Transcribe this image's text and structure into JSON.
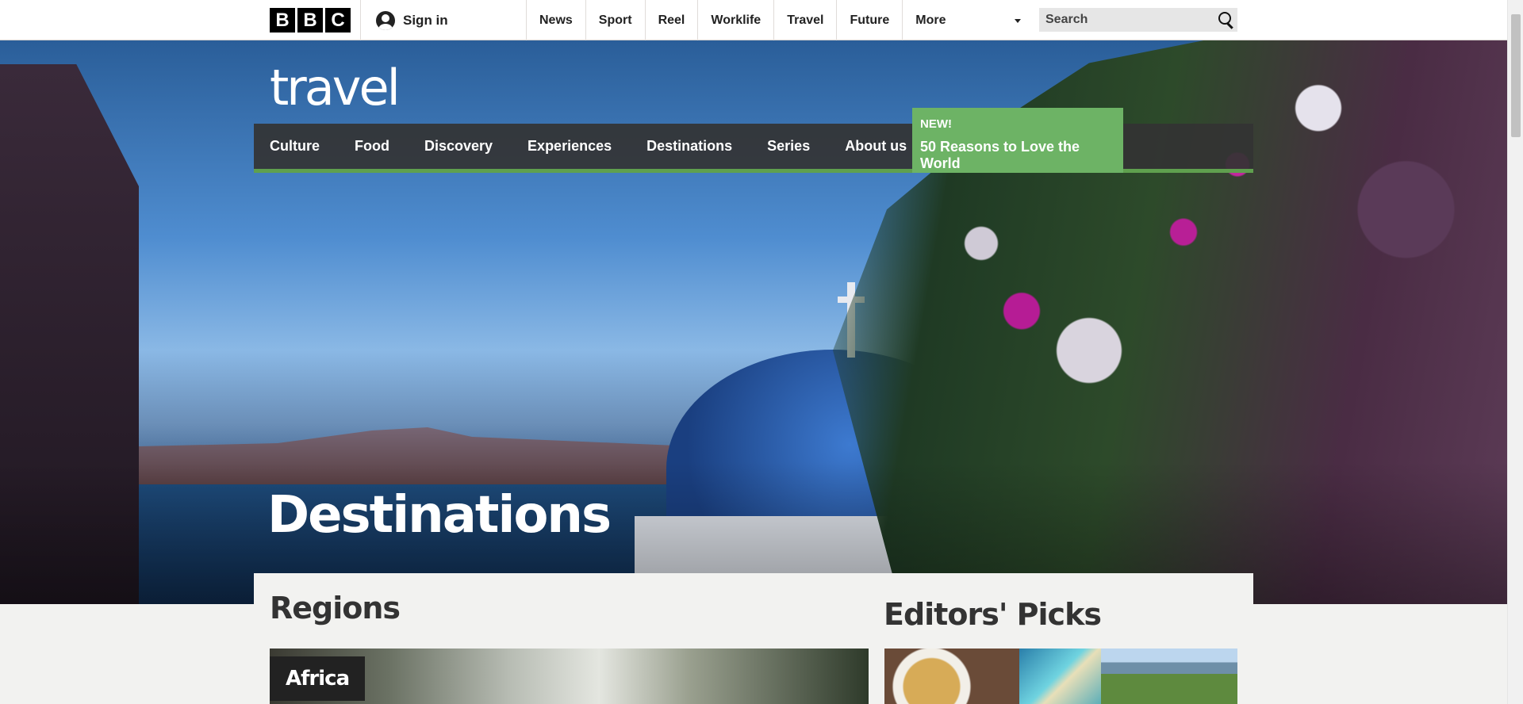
{
  "topbar": {
    "logo_letters": [
      "B",
      "B",
      "C"
    ],
    "sign_in": "Sign in",
    "nav": [
      "News",
      "Sport",
      "Reel",
      "Worklife",
      "Travel",
      "Future",
      "More"
    ],
    "search_placeholder": "Search"
  },
  "hero": {
    "logo": "travel",
    "section_nav": [
      "Culture",
      "Food",
      "Discovery",
      "Experiences",
      "Destinations",
      "Series",
      "About us"
    ],
    "promo": {
      "badge": "NEW!",
      "title": "50 Reasons to Love the World",
      "color": "#6db365"
    },
    "title": "Destinations"
  },
  "content": {
    "regions_title": "Regions",
    "first_region": "Africa",
    "editors_title": "Editors' Picks"
  },
  "colors": {
    "accent": "#5fa04e",
    "nav_bg": "#333333"
  }
}
